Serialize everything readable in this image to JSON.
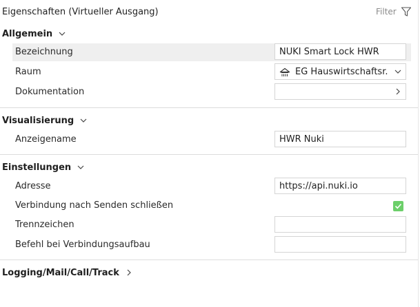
{
  "header": {
    "title": "Eigenschaften (Virtueller Ausgang)",
    "filter_label": "Filter"
  },
  "sections": {
    "allgemein": {
      "label": "Allgemein",
      "rows": {
        "bezeichnung": {
          "label": "Bezeichnung",
          "value": "NUKI Smart Lock HWR"
        },
        "raum": {
          "label": "Raum",
          "value": "EG Hauswirtschaftsr.",
          "icon": "room-icon"
        },
        "dokumentation": {
          "label": "Dokumentation",
          "value": ""
        }
      }
    },
    "visualisierung": {
      "label": "Visualisierung",
      "rows": {
        "anzeigename": {
          "label": "Anzeigename",
          "value": "HWR Nuki"
        }
      }
    },
    "einstellungen": {
      "label": "Einstellungen",
      "rows": {
        "adresse": {
          "label": "Adresse",
          "value": "https://api.nuki.io"
        },
        "verbindung": {
          "label": "Verbindung nach Senden schließen",
          "checked": true
        },
        "trennzeichen": {
          "label": "Trennzeichen",
          "value": ""
        },
        "befehl": {
          "label": "Befehl bei Verbindungsaufbau",
          "value": ""
        }
      }
    },
    "logging": {
      "label": "Logging/Mail/Call/Track"
    }
  },
  "colors": {
    "checkbox": "#6ccf6a",
    "highlight_row": "#efefef",
    "border": "#d4d4d4"
  }
}
